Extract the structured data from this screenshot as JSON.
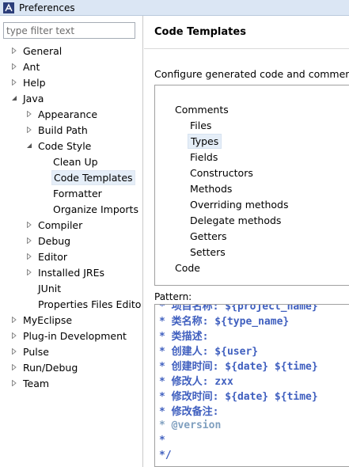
{
  "window": {
    "title": "Preferences"
  },
  "filter": {
    "placeholder": "type filter text"
  },
  "tree": [
    {
      "label": "General",
      "state": "collapsed",
      "depth": 0
    },
    {
      "label": "Ant",
      "state": "collapsed",
      "depth": 0
    },
    {
      "label": "Help",
      "state": "collapsed",
      "depth": 0
    },
    {
      "label": "Java",
      "state": "expanded",
      "depth": 0
    },
    {
      "label": "Appearance",
      "state": "collapsed",
      "depth": 1
    },
    {
      "label": "Build Path",
      "state": "collapsed",
      "depth": 1
    },
    {
      "label": "Code Style",
      "state": "expanded",
      "depth": 1
    },
    {
      "label": "Clean Up",
      "state": "leaf",
      "depth": 2
    },
    {
      "label": "Code Templates",
      "state": "leaf",
      "depth": 2,
      "selected": true
    },
    {
      "label": "Formatter",
      "state": "leaf",
      "depth": 2
    },
    {
      "label": "Organize Imports",
      "state": "leaf",
      "depth": 2
    },
    {
      "label": "Compiler",
      "state": "collapsed",
      "depth": 1
    },
    {
      "label": "Debug",
      "state": "collapsed",
      "depth": 1
    },
    {
      "label": "Editor",
      "state": "collapsed",
      "depth": 1
    },
    {
      "label": "Installed JREs",
      "state": "collapsed",
      "depth": 1
    },
    {
      "label": "JUnit",
      "state": "leaf",
      "depth": 1
    },
    {
      "label": "Properties Files Edito",
      "state": "leaf",
      "depth": 1
    },
    {
      "label": "MyEclipse",
      "state": "collapsed",
      "depth": 0
    },
    {
      "label": "Plug-in Development",
      "state": "collapsed",
      "depth": 0
    },
    {
      "label": "Pulse",
      "state": "collapsed",
      "depth": 0
    },
    {
      "label": "Run/Debug",
      "state": "collapsed",
      "depth": 0
    },
    {
      "label": "Team",
      "state": "collapsed",
      "depth": 0
    }
  ],
  "page": {
    "title": "Code Templates",
    "description": "Configure generated code and comments:"
  },
  "templates": [
    {
      "label": "Comments",
      "depth": 0
    },
    {
      "label": "Files",
      "depth": 1
    },
    {
      "label": "Types",
      "depth": 1,
      "selected": true
    },
    {
      "label": "Fields",
      "depth": 1
    },
    {
      "label": "Constructors",
      "depth": 1
    },
    {
      "label": "Methods",
      "depth": 1
    },
    {
      "label": "Overriding methods",
      "depth": 1
    },
    {
      "label": "Delegate methods",
      "depth": 1
    },
    {
      "label": "Getters",
      "depth": 1
    },
    {
      "label": "Setters",
      "depth": 1
    },
    {
      "label": "Code",
      "depth": 0
    }
  ],
  "pattern": {
    "label": "Pattern:",
    "lines": [
      {
        "text": "* 项目名称: ${project_name}",
        "kind": "text"
      },
      {
        "text": "* 类名称: ${type_name}",
        "kind": "text"
      },
      {
        "text": "* 类描述:",
        "kind": "text"
      },
      {
        "text": "* 创建人: ${user}",
        "kind": "text"
      },
      {
        "text": "* 创建时间: ${date} ${time}",
        "kind": "text"
      },
      {
        "text": "* 修改人: zxx",
        "kind": "text"
      },
      {
        "text": "* 修改时间: ${date} ${time}",
        "kind": "text"
      },
      {
        "text": "* 修改备注:",
        "kind": "text"
      },
      {
        "text": "* @version",
        "kind": "tag"
      },
      {
        "text": "*",
        "kind": "text"
      },
      {
        "text": "*/",
        "kind": "text"
      }
    ]
  },
  "colors": {
    "comment": "#3f5fbf",
    "javadoc_tag": "#7f9fbf",
    "selection": "#e5eef8",
    "titlebar": "#dbe6f4"
  }
}
